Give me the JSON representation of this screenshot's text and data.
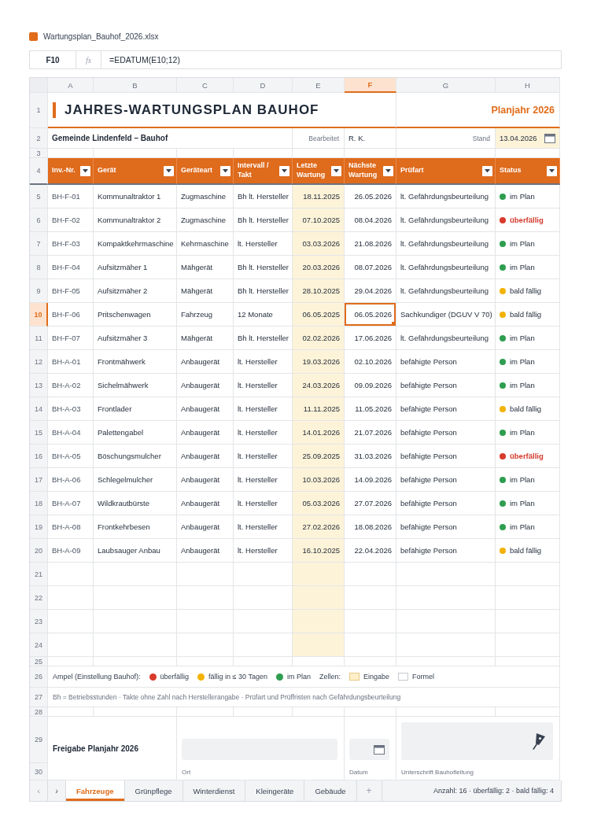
{
  "file": {
    "name": "Wartungsplan_Bauhof_2026.xlsx"
  },
  "formula_bar": {
    "cell_ref": "F10",
    "fx_label": "fx",
    "formula": "=EDATUM(E10;12)"
  },
  "column_headers": [
    {
      "label": "A",
      "selected": false
    },
    {
      "label": "B",
      "selected": false
    },
    {
      "label": "C",
      "selected": false
    },
    {
      "label": "D",
      "selected": false
    },
    {
      "label": "E",
      "selected": false
    },
    {
      "label": "F",
      "selected": true
    },
    {
      "label": "G",
      "selected": false
    },
    {
      "label": "H",
      "selected": false
    }
  ],
  "row_headers": [
    {
      "label": "1",
      "kind": "title",
      "selected": false
    },
    {
      "label": "2",
      "kind": "info",
      "selected": false
    },
    {
      "label": "3",
      "kind": "spacer",
      "selected": false
    },
    {
      "label": "4",
      "kind": "header",
      "selected": false
    },
    {
      "label": "5",
      "kind": "data",
      "selected": false
    },
    {
      "label": "6",
      "kind": "data",
      "selected": false
    },
    {
      "label": "7",
      "kind": "data",
      "selected": false
    },
    {
      "label": "8",
      "kind": "data",
      "selected": false
    },
    {
      "label": "9",
      "kind": "data",
      "selected": false
    },
    {
      "label": "10",
      "kind": "data",
      "selected": true
    },
    {
      "label": "11",
      "kind": "data",
      "selected": false
    },
    {
      "label": "12",
      "kind": "data",
      "selected": false
    },
    {
      "label": "13",
      "kind": "data",
      "selected": false
    },
    {
      "label": "14",
      "kind": "data",
      "selected": false
    },
    {
      "label": "15",
      "kind": "data",
      "selected": false
    },
    {
      "label": "16",
      "kind": "data",
      "selected": false
    },
    {
      "label": "17",
      "kind": "data",
      "selected": false
    },
    {
      "label": "18",
      "kind": "data",
      "selected": false
    },
    {
      "label": "19",
      "kind": "data",
      "selected": false
    },
    {
      "label": "20",
      "kind": "data",
      "selected": false
    },
    {
      "label": "21",
      "kind": "empty",
      "selected": false
    },
    {
      "label": "22",
      "kind": "empty",
      "selected": false
    },
    {
      "label": "23",
      "kind": "empty",
      "selected": false
    },
    {
      "label": "24",
      "kind": "empty",
      "selected": false
    },
    {
      "label": "25",
      "kind": "spacer",
      "selected": false
    },
    {
      "label": "26",
      "kind": "legend",
      "selected": false
    },
    {
      "label": "27",
      "kind": "note",
      "selected": false
    },
    {
      "label": "28",
      "kind": "spacer",
      "selected": false
    },
    {
      "label": "29",
      "kind": "approval",
      "selected": false
    },
    {
      "label": "30",
      "kind": "approval_labels",
      "selected": false
    }
  ],
  "title": "JAHRES-WARTUNGSPLAN BAUHOF",
  "plan_year": "Planjahr 2026",
  "info": {
    "organization": "Gemeinde Lindenfeld – Bauhof",
    "edited_label": "Bearbeitet",
    "edited_by": "R. K.",
    "date_label": "Stand",
    "date": "13.04.2026"
  },
  "table": {
    "columns": [
      {
        "label": "Inv.-Nr.",
        "kind": "id"
      },
      {
        "label": "Gerät",
        "kind": "text"
      },
      {
        "label": "Geräteart",
        "kind": "text"
      },
      {
        "label": "Intervall / Takt",
        "kind": "text"
      },
      {
        "label": "Letzte Wartung",
        "kind": "input_date"
      },
      {
        "label": "Nächste Wartung",
        "kind": "date"
      },
      {
        "label": "Prüfart",
        "kind": "text"
      },
      {
        "label": "Status",
        "kind": "status"
      }
    ],
    "rows": [
      {
        "cells": [
          "BH-F-01",
          "Kommunaltraktor 1",
          "Zugmaschine",
          "Bh lt. Hersteller",
          "18.11.2025",
          "26.05.2026",
          "lt. Gefährdungsbeurteilung"
        ],
        "status": {
          "kind": "ok",
          "label": "im Plan",
          "color": "#2e9d4f"
        }
      },
      {
        "cells": [
          "BH-F-02",
          "Kommunaltraktor 2",
          "Zugmaschine",
          "Bh lt. Hersteller",
          "07.10.2025",
          "08.04.2026",
          "lt. Gefährdungsbeurteilung"
        ],
        "status": {
          "kind": "overdue",
          "label": "überfällig",
          "color": "#d93a2b"
        }
      },
      {
        "cells": [
          "BH-F-03",
          "Kompaktkehrmaschine",
          "Kehrmaschine",
          "lt. Hersteller",
          "03.03.2026",
          "21.08.2026",
          "lt. Gefährdungsbeurteilung"
        ],
        "status": {
          "kind": "ok",
          "label": "im Plan",
          "color": "#2e9d4f"
        }
      },
      {
        "cells": [
          "BH-F-04",
          "Aufsitzmäher 1",
          "Mähgerät",
          "Bh lt. Hersteller",
          "20.03.2026",
          "08.07.2026",
          "lt. Gefährdungsbeurteilung"
        ],
        "status": {
          "kind": "ok",
          "label": "im Plan",
          "color": "#2e9d4f"
        }
      },
      {
        "cells": [
          "BH-F-05",
          "Aufsitzmäher 2",
          "Mähgerät",
          "Bh lt. Hersteller",
          "28.10.2025",
          "29.04.2026",
          "lt. Gefährdungsbeurteilung"
        ],
        "status": {
          "kind": "due",
          "label": "bald fällig",
          "color": "#f2b200"
        }
      },
      {
        "cells": [
          "BH-F-06",
          "Pritschenwagen",
          "Fahrzeug",
          "12 Monate",
          "06.05.2025",
          "06.05.2026",
          "Sachkundiger (DGUV V 70)"
        ],
        "status": {
          "kind": "due",
          "label": "bald fällig",
          "color": "#f2b200"
        }
      },
      {
        "cells": [
          "BH-F-07",
          "Aufsitzmäher 3",
          "Mähgerät",
          "Bh lt. Hersteller",
          "02.02.2026",
          "17.06.2026",
          "lt. Gefährdungsbeurteilung"
        ],
        "status": {
          "kind": "ok",
          "label": "im Plan",
          "color": "#2e9d4f"
        }
      },
      {
        "cells": [
          "BH-A-01",
          "Frontmähwerk",
          "Anbaugerät",
          "lt. Hersteller",
          "19.03.2026",
          "02.10.2026",
          "befähigte Person"
        ],
        "status": {
          "kind": "ok",
          "label": "im Plan",
          "color": "#2e9d4f"
        }
      },
      {
        "cells": [
          "BH-A-02",
          "Sichelmähwerk",
          "Anbaugerät",
          "lt. Hersteller",
          "24.03.2026",
          "09.09.2026",
          "befähigte Person"
        ],
        "status": {
          "kind": "ok",
          "label": "im Plan",
          "color": "#2e9d4f"
        }
      },
      {
        "cells": [
          "BH-A-03",
          "Frontlader",
          "Anbaugerät",
          "lt. Hersteller",
          "11.11.2025",
          "11.05.2026",
          "befähigte Person"
        ],
        "status": {
          "kind": "due",
          "label": "bald fällig",
          "color": "#f2b200"
        }
      },
      {
        "cells": [
          "BH-A-04",
          "Palettengabel",
          "Anbaugerät",
          "lt. Hersteller",
          "14.01.2026",
          "21.07.2026",
          "befähigte Person"
        ],
        "status": {
          "kind": "ok",
          "label": "im Plan",
          "color": "#2e9d4f"
        }
      },
      {
        "cells": [
          "BH-A-05",
          "Böschungsmulcher",
          "Anbaugerät",
          "lt. Hersteller",
          "25.09.2025",
          "31.03.2026",
          "befähigte Person"
        ],
        "status": {
          "kind": "overdue",
          "label": "überfällig",
          "color": "#d93a2b"
        }
      },
      {
        "cells": [
          "BH-A-06",
          "Schlegelmulcher",
          "Anbaugerät",
          "lt. Hersteller",
          "10.03.2026",
          "14.09.2026",
          "befähigte Person"
        ],
        "status": {
          "kind": "ok",
          "label": "im Plan",
          "color": "#2e9d4f"
        }
      },
      {
        "cells": [
          "BH-A-07",
          "Wildkrautbürste",
          "Anbaugerät",
          "lt. Hersteller",
          "05.03.2026",
          "27.07.2026",
          "befähigte Person"
        ],
        "status": {
          "kind": "ok",
          "label": "im Plan",
          "color": "#2e9d4f"
        }
      },
      {
        "cells": [
          "BH-A-08",
          "Frontkehrbesen",
          "Anbaugerät",
          "lt. Hersteller",
          "27.02.2026",
          "18.08.2026",
          "befähigte Person"
        ],
        "status": {
          "kind": "ok",
          "label": "im Plan",
          "color": "#2e9d4f"
        }
      },
      {
        "cells": [
          "BH-A-09",
          "Laubsauger Anbau",
          "Anbaugerät",
          "lt. Hersteller",
          "16.10.2025",
          "22.04.2026",
          "befähigte Person"
        ],
        "status": {
          "kind": "due",
          "label": "bald fällig",
          "color": "#f2b200"
        }
      }
    ]
  },
  "legend": {
    "label": "Ampel (Einstellung Bauhof):",
    "items": [
      {
        "label": "überfällig",
        "color": "#d93a2b"
      },
      {
        "label": "fällig in ≤ 30 Tagen",
        "color": "#f2b200"
      },
      {
        "label": "im Plan",
        "color": "#2e9d4f"
      }
    ],
    "cells_label": "Zellen:",
    "cell_types": [
      {
        "label": "Eingabe",
        "kind": "input"
      },
      {
        "label": "Formel",
        "kind": "formula"
      }
    ]
  },
  "note": "Bh = Betriebsstunden · Takte ohne Zahl nach Herstellerangabe · Prüfart und Prüffristen nach Gefährdungsbeurteilung",
  "approval": {
    "title": "Freigabe Planjahr 2026",
    "fields": [
      {
        "kind": "text",
        "label": "Ort"
      },
      {
        "kind": "date",
        "label": "Datum"
      },
      {
        "kind": "signature",
        "label": "Unterschrift Bauhofleitung"
      }
    ]
  },
  "sheet_tabs": {
    "nav": [
      {
        "kind": "previous",
        "label": "‹"
      },
      {
        "kind": "next",
        "label": "›"
      }
    ],
    "tabs": [
      {
        "label": "Fahrzeuge",
        "selected": true
      },
      {
        "label": "Grünpflege",
        "selected": false
      },
      {
        "label": "Winterdienst",
        "selected": false
      },
      {
        "label": "Kleingeräte",
        "selected": false
      },
      {
        "label": "Gebäude",
        "selected": false
      }
    ],
    "add": "+",
    "summary": "Anzahl: 16 · überfällig: 2 · bald fällig: 4"
  }
}
